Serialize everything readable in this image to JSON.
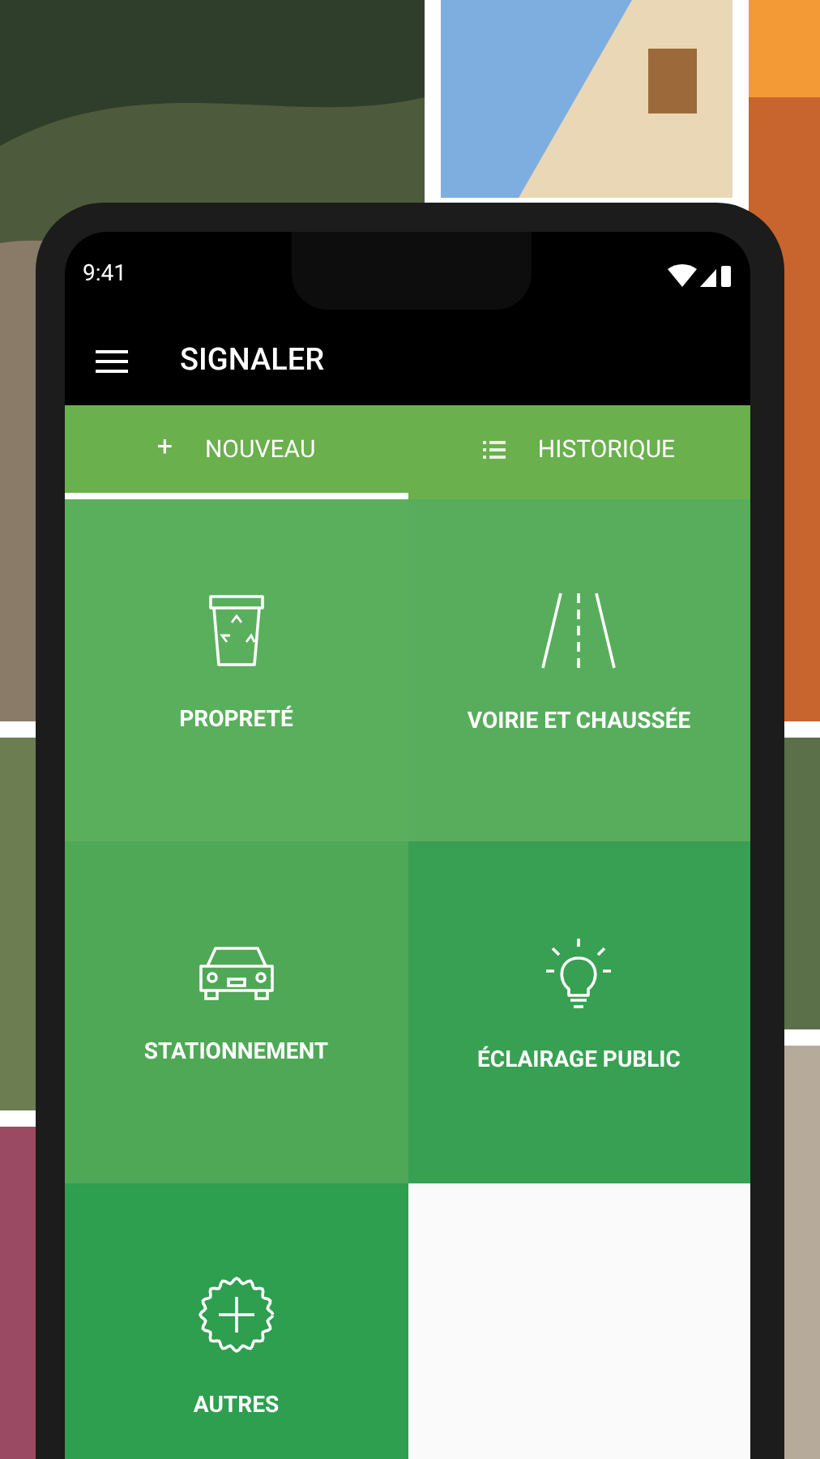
{
  "status_bar": {
    "time": "9:41"
  },
  "app_bar": {
    "title": "SIGNALER"
  },
  "tabs": [
    {
      "label": "NOUVEAU",
      "icon": "+",
      "selected": true
    },
    {
      "label": "HISTORIQUE",
      "selected": false
    }
  ],
  "tiles": [
    {
      "label": "PROPRETÉ",
      "color": "#5aaf5d"
    },
    {
      "label": "VOIRIE ET CHAUSSÉE",
      "color": "#58ad5c"
    },
    {
      "label": "STATIONNEMENT",
      "color": "#4fa856"
    },
    {
      "label": "ÉCLAIRAGE PUBLIC",
      "color": "#38a052"
    },
    {
      "label": "AUTRES",
      "color": "#2e9e4f"
    }
  ]
}
